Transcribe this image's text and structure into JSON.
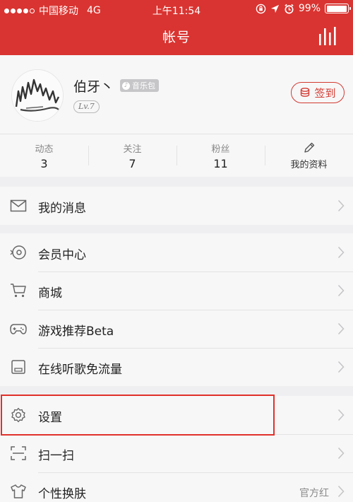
{
  "status": {
    "carrier": "中国移动",
    "network": "4G",
    "time": "上午11:54",
    "battery": "99%",
    "battery_level": 0.99
  },
  "header": {
    "title": "帐号"
  },
  "profile": {
    "name": "伯牙丶",
    "vip_badge": "音乐包",
    "level": "Lv.7",
    "checkin": "签到"
  },
  "stats": [
    {
      "label": "动态",
      "value": "3"
    },
    {
      "label": "关注",
      "value": "7"
    },
    {
      "label": "粉丝",
      "value": "11"
    }
  ],
  "edit_profile": "我的资料",
  "menu": {
    "messages": "我的消息",
    "member": "会员中心",
    "store": "商城",
    "games": "游戏推荐Beta",
    "free_traffic": "在线听歌免流量",
    "settings": "设置",
    "scan": "扫一扫",
    "theme": "个性换肤",
    "theme_value": "官方红"
  },
  "colors": {
    "brand_red": "#d93431",
    "highlight": "#e0312a"
  }
}
